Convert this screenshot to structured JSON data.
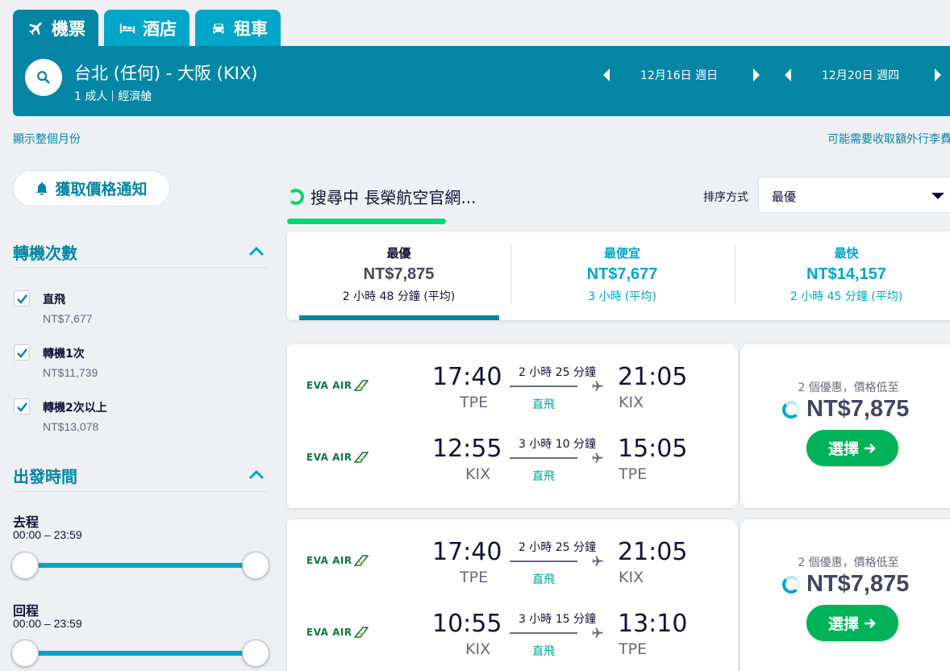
{
  "tabs": [
    {
      "label": "機票",
      "icon": "airplane-icon",
      "active": true
    },
    {
      "label": "酒店",
      "icon": "bed-icon",
      "active": false
    },
    {
      "label": "租車",
      "icon": "car-icon",
      "active": false
    }
  ],
  "search": {
    "route": "台北 (任何) - 大阪 (KIX)",
    "passengers": "1 成人",
    "cabin": "經濟艙",
    "depart_date": "12月16日 週日",
    "return_date": "12月20日 週四"
  },
  "links": {
    "show_month": "顯示整個月份",
    "baggage_note": "可能需要收取額外行李費"
  },
  "price_alert_label": "獲取價格通知",
  "filters": {
    "stops_title": "轉機次數",
    "stops": [
      {
        "label": "直飛",
        "price": "NT$7,677",
        "checked": true
      },
      {
        "label": "轉機1次",
        "price": "NT$11,739",
        "checked": true
      },
      {
        "label": "轉機2次以上",
        "price": "NT$13,078",
        "checked": true
      }
    ],
    "times_title": "出發時間",
    "outbound_label": "去程",
    "outbound_range": "00:00 – 23:59",
    "inbound_label": "回程",
    "inbound_range": "00:00 – 23:59"
  },
  "status": {
    "searching_text": "搜尋中 長榮航空官網...",
    "sort_label": "排序方式",
    "sort_value": "最優"
  },
  "summary": [
    {
      "title": "最優",
      "price": "NT$7,875",
      "duration": "2 小時 48 分鐘 (平均)"
    },
    {
      "title": "最便宜",
      "price": "NT$7,677",
      "duration": "3 小時 (平均)"
    },
    {
      "title": "最快",
      "price": "NT$14,157",
      "duration": "2 小時 45 分鐘 (平均)"
    }
  ],
  "results": [
    {
      "legs": [
        {
          "airline": "EVA AIR",
          "dep_time": "17:40",
          "dep_airport": "TPE",
          "duration": "2 小時 25 分鐘",
          "stops": "直飛",
          "arr_time": "21:05",
          "arr_airport": "KIX"
        },
        {
          "airline": "EVA AIR",
          "dep_time": "12:55",
          "dep_airport": "KIX",
          "duration": "3 小時 10 分鐘",
          "stops": "直飛",
          "arr_time": "15:05",
          "arr_airport": "TPE"
        }
      ],
      "deals": "2 個優惠，價格低至",
      "price": "NT$7,875",
      "select_label": "選擇"
    },
    {
      "legs": [
        {
          "airline": "EVA AIR",
          "dep_time": "17:40",
          "dep_airport": "TPE",
          "duration": "2 小時 25 分鐘",
          "stops": "直飛",
          "arr_time": "21:05",
          "arr_airport": "KIX"
        },
        {
          "airline": "EVA AIR",
          "dep_time": "10:55",
          "dep_airport": "KIX",
          "duration": "3 小時 15 分鐘",
          "stops": "直飛",
          "arr_time": "13:10",
          "arr_airport": "TPE"
        }
      ],
      "deals": "2 個優惠，價格低至",
      "price": "NT$7,875",
      "select_label": "選擇"
    }
  ],
  "colors": {
    "brand_dark": "#0586a4",
    "brand_light": "#00a6c8",
    "accent_green": "#00b359",
    "progress_green": "#00d775"
  }
}
